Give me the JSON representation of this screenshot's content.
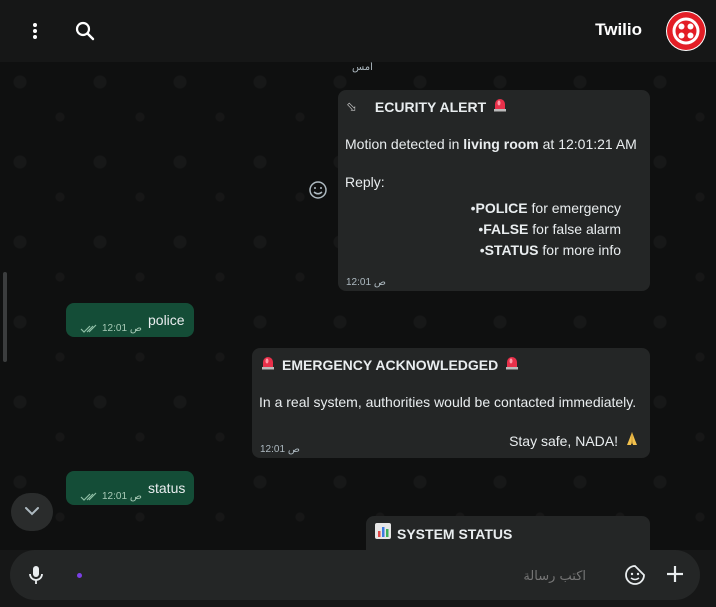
{
  "header": {
    "title": "Twilio"
  },
  "chat": {
    "date_label": "أمس",
    "security_alert": {
      "title": "ECURITY ALERT",
      "line1_pre": "Motion detected in ",
      "line1_bold": "living room",
      "line1_post": " at 12:01:21 AM",
      "reply": "Reply:",
      "options": [
        {
          "bullet": "•",
          "keyword": "POLICE",
          "text": " for emergency"
        },
        {
          "bullet": "•",
          "keyword": "FALSE",
          "text": " for false alarm"
        },
        {
          "bullet": "•",
          "keyword": "STATUS",
          "text": " for more info"
        }
      ],
      "time": "12:01 ص"
    },
    "outgoing1": {
      "text": "police",
      "time": "12:01 ص"
    },
    "emergency": {
      "title": "EMERGENCY ACKNOWLEDGED",
      "body": "In a real system, authorities would be contacted immediately.",
      "closing": "Stay safe, NADA!",
      "time": "12:01 ص"
    },
    "outgoing2": {
      "text": "status",
      "time": "12:01 ص"
    },
    "system_status": {
      "title": "SYSTEM STATUS"
    }
  },
  "input": {
    "placeholder": "اكتب رسالة"
  },
  "colors": {
    "outgoing": "#144d37",
    "incoming": "#242626",
    "twilio": "#e31e26"
  },
  "icons": [
    "more-icon",
    "search-icon",
    "twilio-logo",
    "emoji-icon",
    "siren-icon",
    "pray-icon",
    "chart-icon",
    "read-ticks-icon",
    "chevron-down-icon",
    "mic-icon",
    "sticker-icon",
    "plus-icon"
  ]
}
